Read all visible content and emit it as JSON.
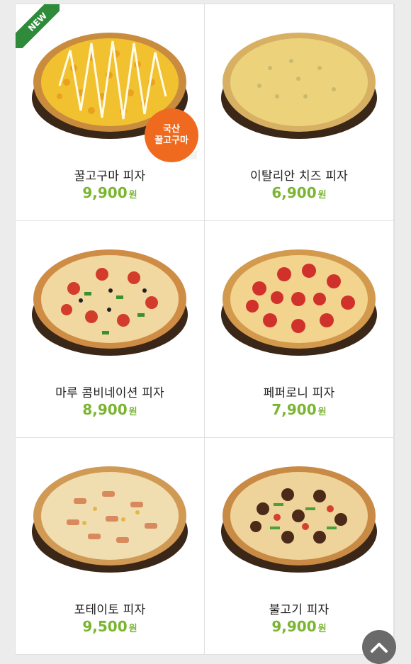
{
  "badges": {
    "new_label": "NEW",
    "domestic_line1": "국산",
    "domestic_line2": "꿀고구마"
  },
  "menu": [
    {
      "name": "꿀고구마 피자",
      "price": "9,900",
      "currency": "원",
      "icon": "sweet-potato-pizza-image"
    },
    {
      "name": "이탈리안 치즈 피자",
      "price": "6,900",
      "currency": "원",
      "icon": "cheese-pizza-image"
    },
    {
      "name": "마루 콤비네이션 피자",
      "price": "8,900",
      "currency": "원",
      "icon": "combination-pizza-image"
    },
    {
      "name": "페퍼로니 피자",
      "price": "7,900",
      "currency": "원",
      "icon": "pepperoni-pizza-image"
    },
    {
      "name": "포테이토 피자",
      "price": "9,500",
      "currency": "원",
      "icon": "potato-pizza-image"
    },
    {
      "name": "불고기 피자",
      "price": "9,900",
      "currency": "원",
      "icon": "bulgogi-pizza-image"
    }
  ],
  "colors": {
    "price": "#7ab530",
    "new_ribbon": "#2e8b3a",
    "badge": "#ef6a1f"
  },
  "scroll_top_icon": "chevron-up-icon"
}
